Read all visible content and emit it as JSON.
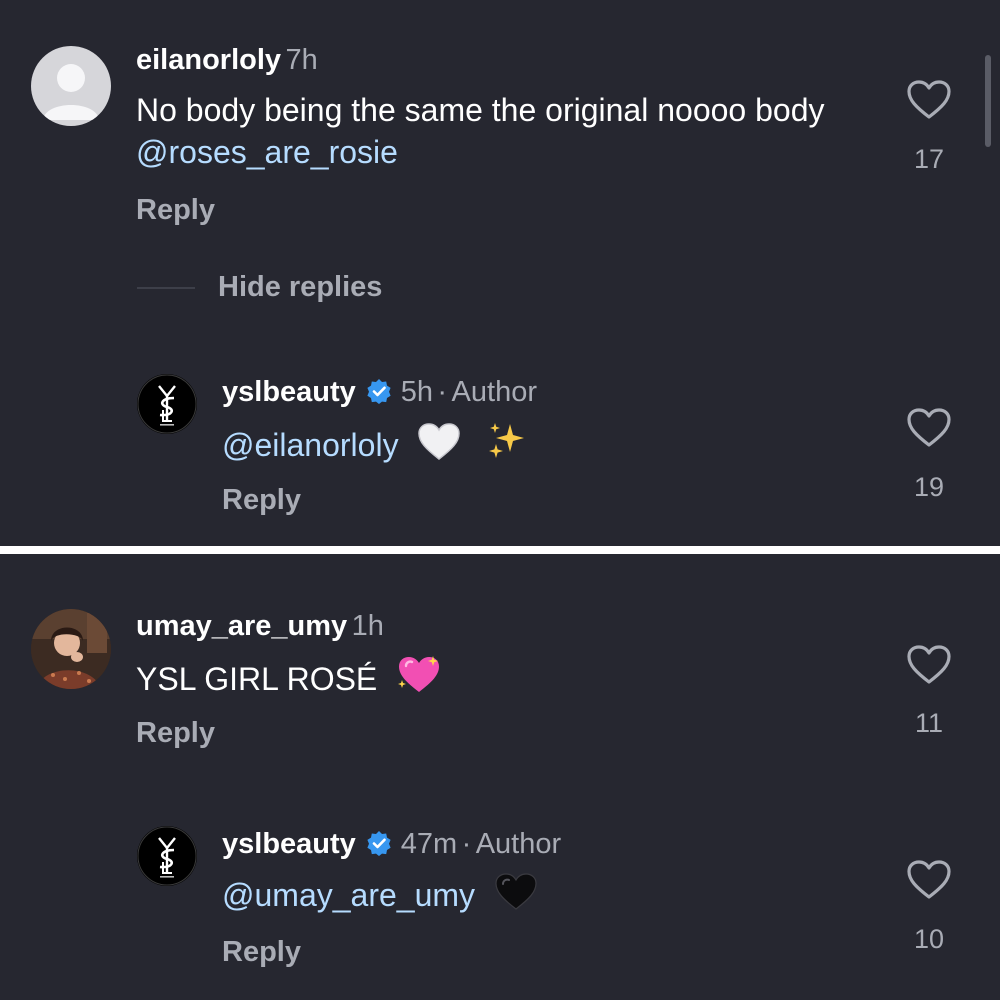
{
  "comments": [
    {
      "username": "eilanorloly",
      "time": "7h",
      "text": "No body being the same the original noooo body",
      "mention": "@roses_are_rosie",
      "reply_label": "Reply",
      "hide_replies_label": "Hide replies",
      "like_count": "17",
      "avatar_icon": "default-avatar-icon",
      "reply": {
        "username": "yslbeauty",
        "time": "5h",
        "separator": "·",
        "author_label": "Author",
        "mention": "@eilanorloly",
        "emoji": [
          "white-heart-icon",
          "sparkles-icon"
        ],
        "reply_label": "Reply",
        "like_count": "19",
        "avatar_icon": "ysl-logo-icon"
      }
    },
    {
      "username": "umay_are_umy",
      "time": "1h",
      "text": "YSL GIRL ROSÉ",
      "emoji": [
        "sparkling-heart-icon"
      ],
      "reply_label": "Reply",
      "like_count": "11",
      "avatar_icon": "profile-photo-avatar",
      "reply": {
        "username": "yslbeauty",
        "time": "47m",
        "separator": "·",
        "author_label": "Author",
        "mention": "@umay_are_umy",
        "emoji": [
          "black-heart-icon"
        ],
        "reply_label": "Reply",
        "like_count": "10",
        "avatar_icon": "ysl-logo-icon"
      }
    }
  ],
  "colors": {
    "background": "#262730",
    "divider": "#ffffff",
    "username": "#ffffff",
    "muted": "#a9acb5",
    "mention": "#b6dcff",
    "verified": "#3797f0"
  }
}
